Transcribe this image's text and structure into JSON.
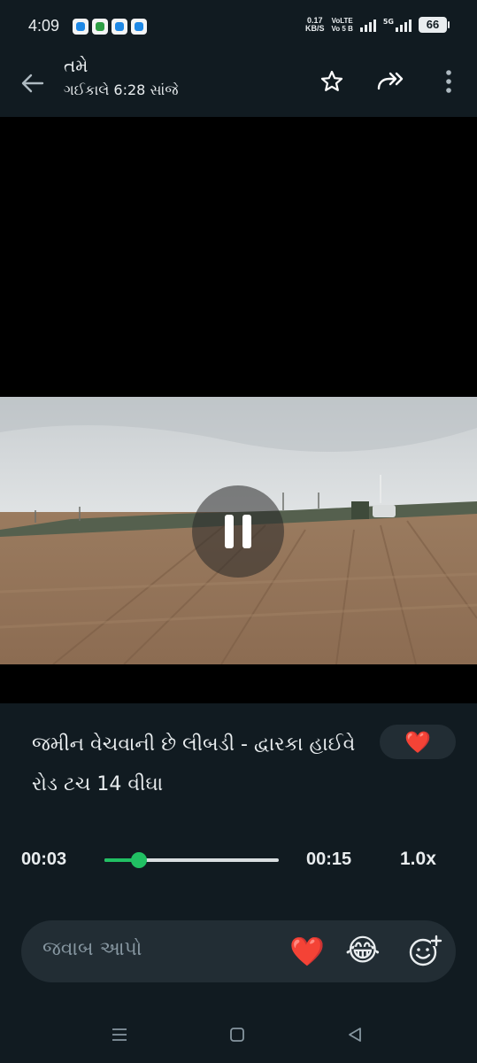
{
  "status_bar": {
    "time": "4:09",
    "net_speed_value": "0.17",
    "net_speed_unit": "KB/S",
    "volte_top": "VoLTE",
    "volte_bottom": "Vo 5 B",
    "network_label": "5G",
    "battery": "66"
  },
  "header": {
    "title": "તમે",
    "subtitle": "ગઈકાલે 6:28 સાંજે",
    "icons": [
      "back-arrow-icon",
      "star-icon",
      "forward-icon",
      "more-vert-icon"
    ]
  },
  "media": {
    "caption": "જમીન વેચવાની છે લીબડી - દ્વારકા હાઈવે રોડ ટચ 14 વીઘા",
    "reaction": "❤️",
    "current_time": "00:03",
    "total_time": "00:15",
    "playback_speed": "1.0x",
    "progress_fraction": 0.2
  },
  "reply": {
    "placeholder": "જવાબ આપો",
    "heart": "❤️",
    "laugh": "😂"
  },
  "colors": {
    "accent": "#21c063",
    "panel": "#111b21",
    "input_bg": "#222d34"
  }
}
